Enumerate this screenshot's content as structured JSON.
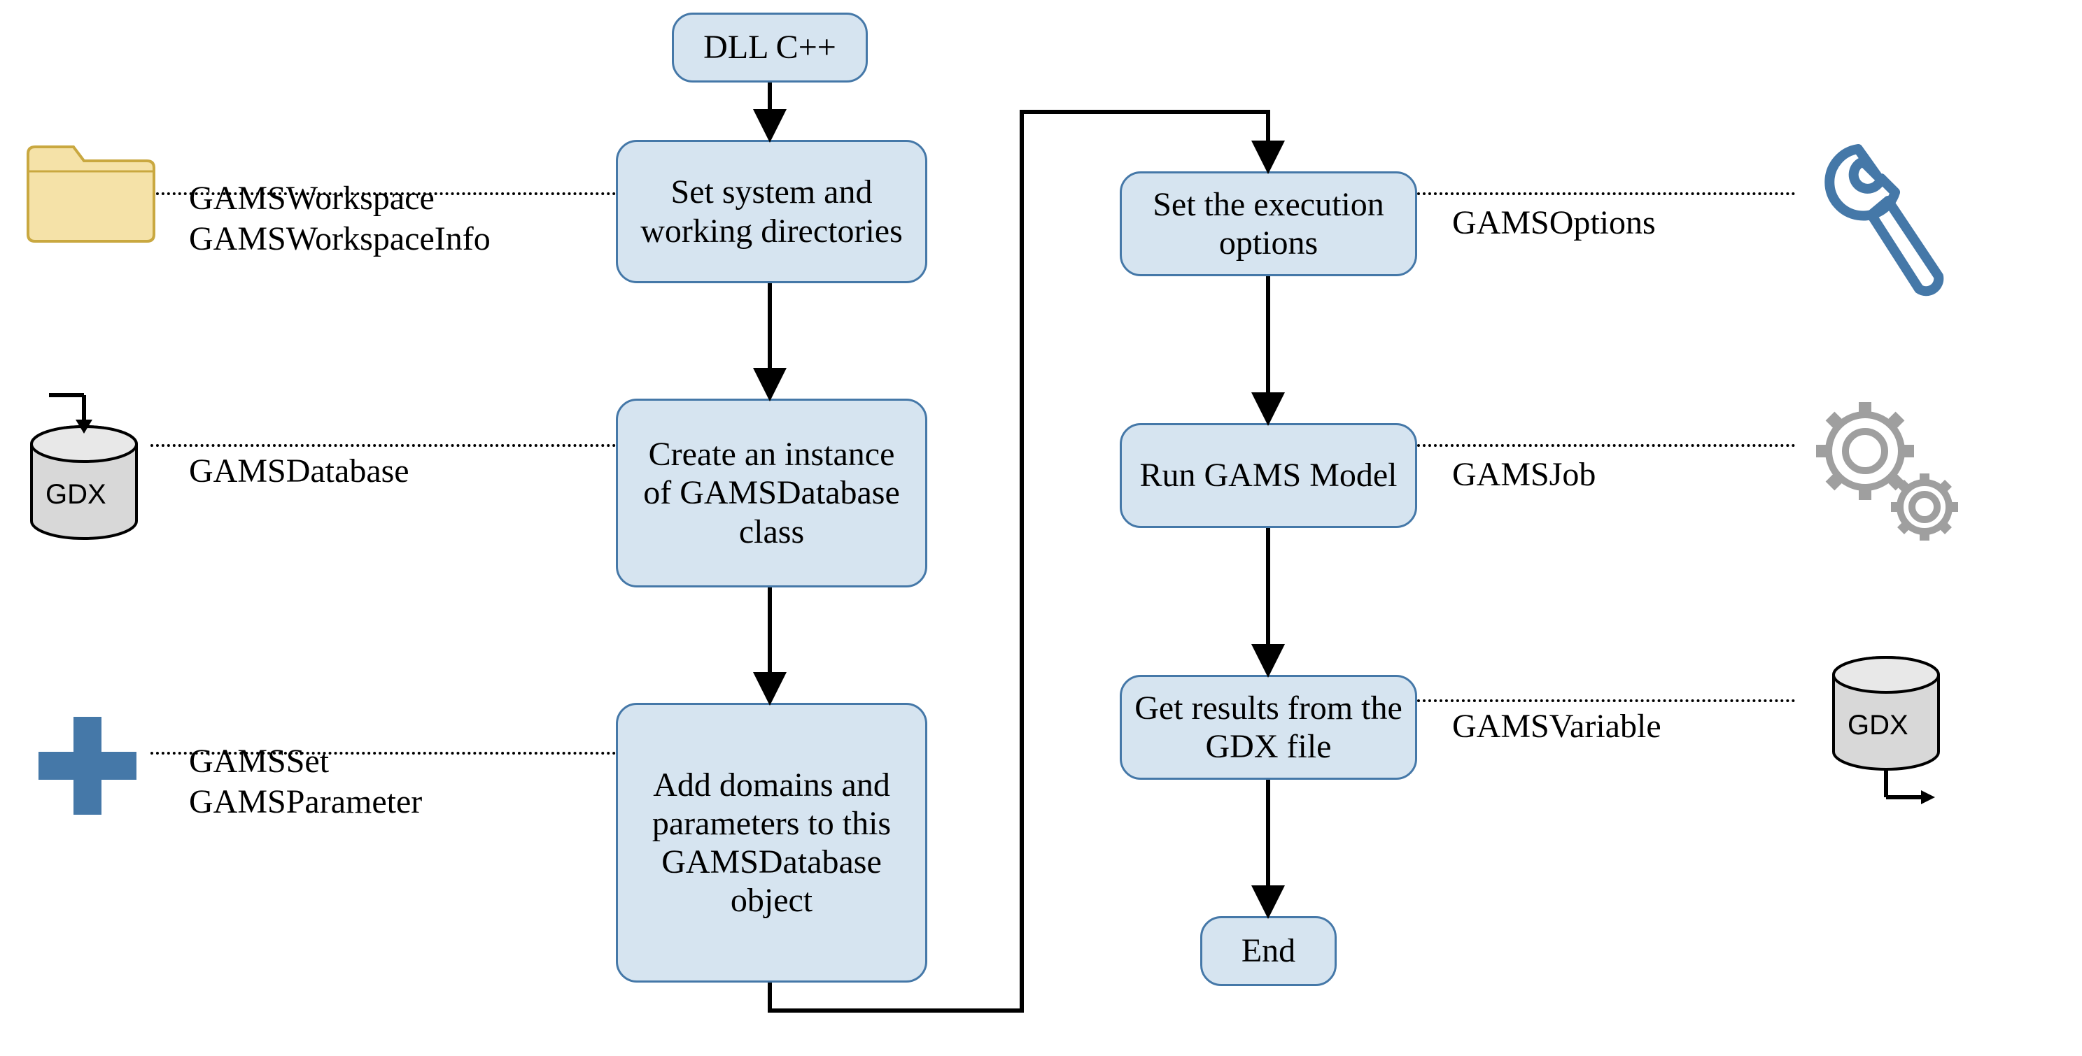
{
  "nodes": {
    "dll": "DLL C++",
    "set_dirs": "Set system and working directories",
    "create_db": "Create an instance of GAMSDatabase class",
    "add_domains": "Add domains and parameters to this GAMSDatabase object",
    "set_options": "Set the execution options",
    "run_model": "Run GAMS Model",
    "get_results": "Get results from the GDX file",
    "end": "End"
  },
  "labels": {
    "workspace_line1": "GAMSWorkspace",
    "workspace_line2": "GAMSWorkspaceInfo",
    "database": "GAMSDatabase",
    "set_line1": "GAMSSet",
    "set_line2": "GAMSParameter",
    "options": "GAMSOptions",
    "job": "GAMSJob",
    "variable": "GAMSVariable"
  },
  "icons": {
    "folder": "folder-icon",
    "gdx_in": "gdx-database-input-icon",
    "plus": "plus-icon",
    "wrench": "wrench-icon",
    "gears": "gears-icon",
    "gdx_out": "gdx-database-output-icon",
    "gdx_text": "GDX"
  }
}
